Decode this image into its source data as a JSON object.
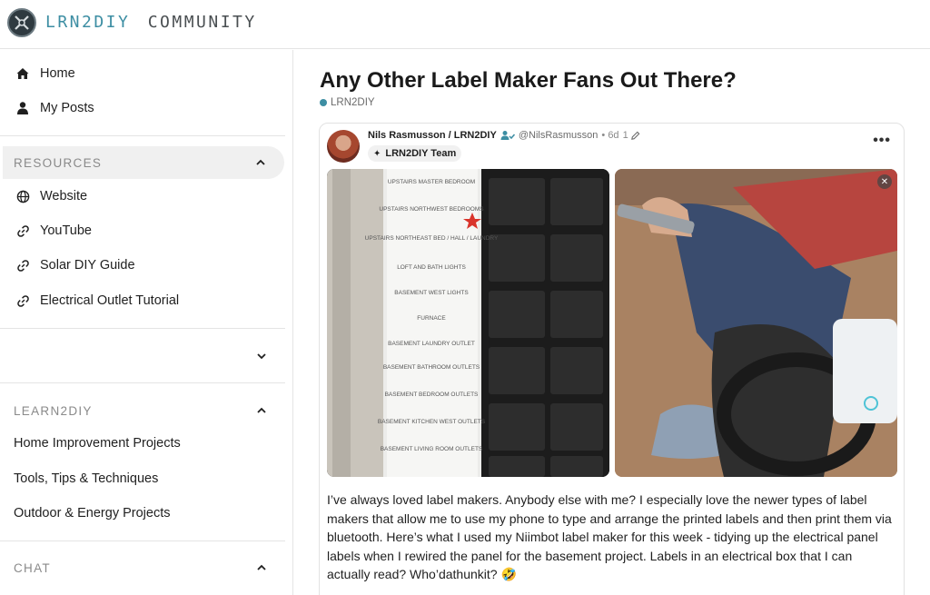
{
  "header": {
    "logo_brand": "LRN2DIY",
    "logo_suffix": "COMMUNITY"
  },
  "sidebar": {
    "top_items": [
      {
        "label": "Home",
        "icon": "home-icon"
      },
      {
        "label": "My Posts",
        "icon": "person-icon"
      }
    ],
    "resources": {
      "heading": "RESOURCES",
      "items": [
        {
          "label": "Website",
          "icon": "globe-icon"
        },
        {
          "label": "YouTube",
          "icon": "link-icon"
        },
        {
          "label": "Solar DIY Guide",
          "icon": "link-icon"
        },
        {
          "label": "Electrical Outlet Tutorial",
          "icon": "link-icon"
        }
      ]
    },
    "learn2diy": {
      "heading": "LEARN2DIY",
      "items": [
        {
          "label": "Home Improvement Projects"
        },
        {
          "label": "Tools, Tips & Techniques"
        },
        {
          "label": "Outdoor & Energy Projects"
        }
      ]
    },
    "chat": {
      "heading": "CHAT"
    }
  },
  "post": {
    "title": "Any Other Label Maker Fans Out There?",
    "space": "LRN2DIY",
    "author": "Nils Rasmusson / LRN2DIY",
    "handle": "@NilsRasmusson",
    "age": "• 6d",
    "edits": "1",
    "team_badge": "LRN2DIY Team",
    "body": "I’ve always loved label makers. Anybody else with me? I especially love the newer types of label makers that allow me to use my phone to type and arrange the printed labels and then print them via bluetooth. Here’s what I used my Niimbot label maker for this week - tidying up the electrical panel labels when I rewired the panel for the basement project. Labels in an electrical box that I can actually read? Who’dathunkit? 🤣",
    "panel_labels": [
      "UPSTAIRS MASTER BEDROOM",
      "UPSTAIRS NORTHWEST BEDROOMS",
      "UPSTAIRS NORTHEAST BED / HALL / LAUNDRY",
      "LOFT AND BATH LIGHTS",
      "BASEMENT WEST LIGHTS",
      "FURNACE",
      "BASEMENT LAUNDRY OUTLET",
      "BASEMENT BATHROOM OUTLETS",
      "BASEMENT BEDROOM OUTLETS",
      "BASEMENT KITCHEN WEST OUTLETS",
      "BASEMENT LIVING ROOM OUTLETS"
    ]
  },
  "colors": {
    "accent": "#3d8ea3",
    "border": "#e4e4e4",
    "active_bg": "#f0f0f0"
  }
}
